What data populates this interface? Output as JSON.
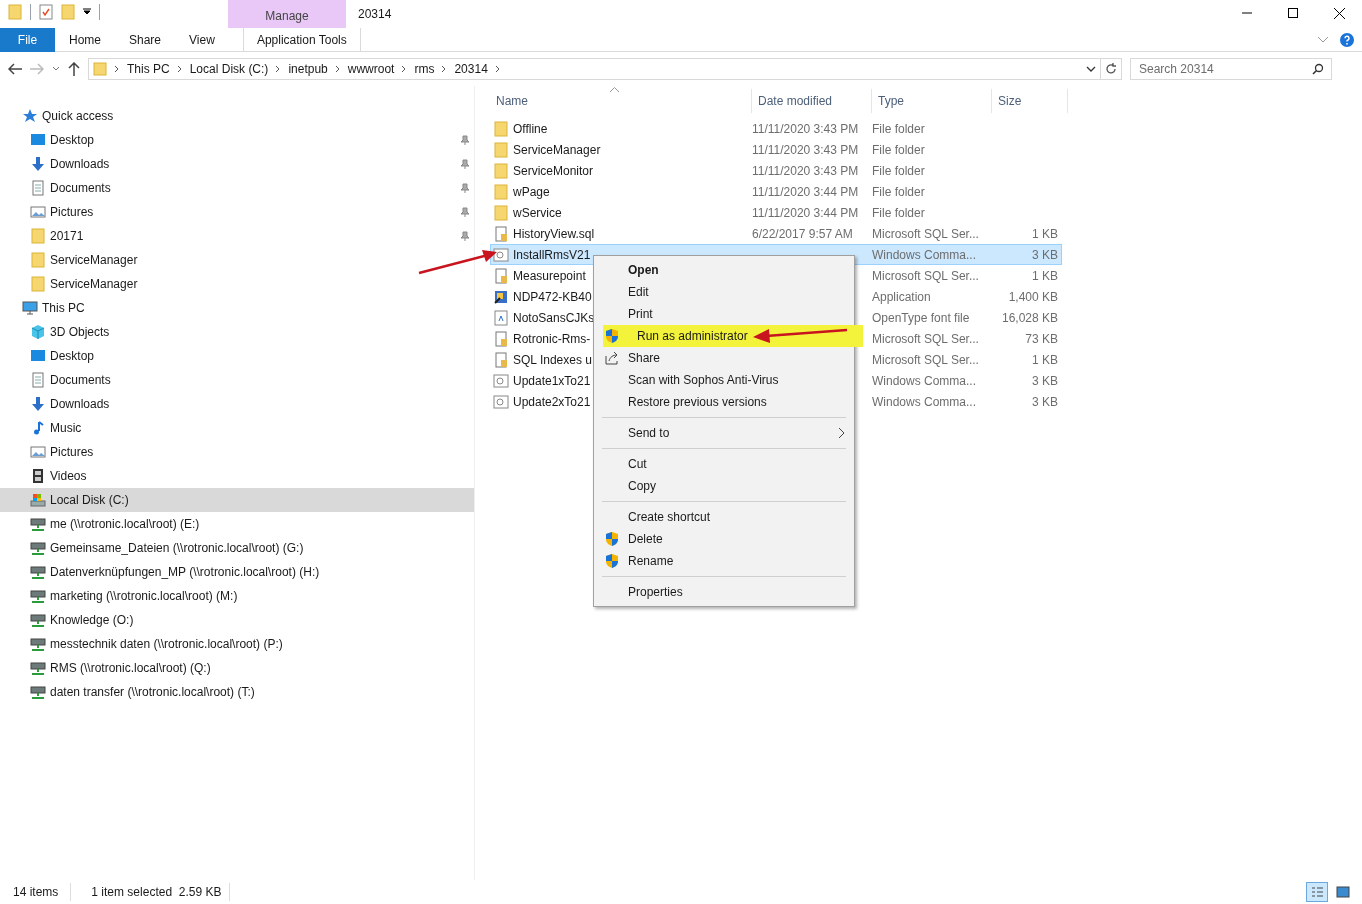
{
  "window": {
    "title": "20314",
    "context_tab_group": "Manage"
  },
  "ribbon_tabs": [
    {
      "label": "File",
      "kind": "file",
      "selected": false
    },
    {
      "label": "Home",
      "kind": "tab",
      "selected": false
    },
    {
      "label": "Share",
      "kind": "tab",
      "selected": false
    },
    {
      "label": "View",
      "kind": "tab",
      "selected": false
    },
    {
      "label": "Application Tools",
      "kind": "context",
      "selected": false
    }
  ],
  "breadcrumb": [
    "This PC",
    "Local Disk (C:)",
    "inetpub",
    "wwwroot",
    "rms",
    "20314"
  ],
  "search": {
    "placeholder": "Search 20314"
  },
  "sidebar": [
    {
      "label": "Quick access",
      "kind": "star",
      "selected": false,
      "children": [
        {
          "label": "Desktop",
          "kind": "desktop",
          "pinned": true,
          "selected": false
        },
        {
          "label": "Downloads",
          "kind": "download",
          "pinned": true,
          "selected": false
        },
        {
          "label": "Documents",
          "kind": "document",
          "pinned": true,
          "selected": false
        },
        {
          "label": "Pictures",
          "kind": "picture",
          "pinned": true,
          "selected": false
        },
        {
          "label": "20171",
          "kind": "folder",
          "pinned": true,
          "selected": false
        },
        {
          "label": "ServiceManager",
          "kind": "folder",
          "pinned": false,
          "selected": false
        },
        {
          "label": "ServiceManager",
          "kind": "folder",
          "pinned": false,
          "selected": false
        }
      ]
    },
    {
      "label": "This PC",
      "kind": "computer",
      "selected": false,
      "children": [
        {
          "label": "3D Objects",
          "kind": "cube",
          "pinned": false,
          "selected": false
        },
        {
          "label": "Desktop",
          "kind": "desktop",
          "pinned": false,
          "selected": false
        },
        {
          "label": "Documents",
          "kind": "document",
          "pinned": false,
          "selected": false
        },
        {
          "label": "Downloads",
          "kind": "download",
          "pinned": false,
          "selected": false
        },
        {
          "label": "Music",
          "kind": "music",
          "pinned": false,
          "selected": false
        },
        {
          "label": "Pictures",
          "kind": "picture",
          "pinned": false,
          "selected": false
        },
        {
          "label": "Videos",
          "kind": "video",
          "pinned": false,
          "selected": false
        },
        {
          "label": "Local Disk (C:)",
          "kind": "disk",
          "pinned": false,
          "selected": true
        },
        {
          "label": "me (\\\\rotronic.local\\root) (E:)",
          "kind": "netdrive",
          "pinned": false,
          "selected": false
        },
        {
          "label": "Gemeinsame_Dateien (\\\\rotronic.local\\root) (G:)",
          "kind": "netdrive",
          "pinned": false,
          "selected": false
        },
        {
          "label": "Datenverknüpfungen_MP (\\\\rotronic.local\\root) (H:)",
          "kind": "netdrive",
          "pinned": false,
          "selected": false
        },
        {
          "label": "marketing (\\\\rotronic.local\\root) (M:)",
          "kind": "netdrive",
          "pinned": false,
          "selected": false
        },
        {
          "label": "Knowledge (O:)",
          "kind": "netdrive",
          "pinned": false,
          "selected": false
        },
        {
          "label": "messtechnik daten (\\\\rotronic.local\\root) (P:)",
          "kind": "netdrive",
          "pinned": false,
          "selected": false
        },
        {
          "label": "RMS (\\\\rotronic.local\\root) (Q:)",
          "kind": "netdrive",
          "pinned": false,
          "selected": false
        },
        {
          "label": "daten transfer (\\\\rotronic.local\\root) (T:)",
          "kind": "netdrive",
          "pinned": false,
          "selected": false
        }
      ]
    }
  ],
  "table": {
    "columns": [
      "Name",
      "Date modified",
      "Type",
      "Size"
    ],
    "rows": [
      {
        "kind": "folder",
        "name": "Offline",
        "date": "11/11/2020 3:43 PM",
        "type": "File folder",
        "selected": false
      },
      {
        "kind": "folder",
        "name": "ServiceManager",
        "date": "11/11/2020 3:43 PM",
        "type": "File folder",
        "selected": false
      },
      {
        "kind": "folder",
        "name": "ServiceMonitor",
        "date": "11/11/2020 3:43 PM",
        "type": "File folder",
        "selected": false
      },
      {
        "kind": "folder",
        "name": "wPage",
        "date": "11/11/2020 3:44 PM",
        "type": "File folder",
        "selected": false
      },
      {
        "kind": "folder",
        "name": "wService",
        "date": "11/11/2020 3:44 PM",
        "type": "File folder",
        "selected": false
      },
      {
        "kind": "sql",
        "name": "HistoryView.sql",
        "date": "6/22/2017 9:57 AM",
        "type": "Microsoft SQL Ser...",
        "size": "1 KB",
        "selected": false
      },
      {
        "kind": "cmd",
        "name": "InstallRmsV21",
        "type": "Windows Comma...",
        "size": "3 KB",
        "selected": true
      },
      {
        "kind": "sql",
        "name": "Measurepoint",
        "type": "Microsoft SQL Ser...",
        "size": "1 KB",
        "selected": false
      },
      {
        "kind": "app",
        "name": "NDP472-KB40",
        "type": "Application",
        "size": "1,400 KB",
        "selected": false
      },
      {
        "kind": "font",
        "name": "NotoSansCJKs",
        "type": "OpenType font file",
        "size": "16,028 KB",
        "selected": false
      },
      {
        "kind": "sql",
        "name": "Rotronic-Rms-",
        "type": "Microsoft SQL Ser...",
        "size": "73 KB",
        "selected": false
      },
      {
        "kind": "sql",
        "name": "SQL Indexes u",
        "type": "Microsoft SQL Ser...",
        "size": "1 KB",
        "selected": false
      },
      {
        "kind": "cmd",
        "name": "Update1xTo21",
        "type": "Windows Comma...",
        "size": "3 KB",
        "selected": false
      },
      {
        "kind": "cmd",
        "name": "Update2xTo21",
        "type": "Windows Comma...",
        "size": "3 KB",
        "selected": false
      }
    ]
  },
  "context_menu": {
    "groups": [
      [
        {
          "label": "Open",
          "kind": "plain",
          "default": true,
          "highlighted": false,
          "submenu": false
        },
        {
          "label": "Edit",
          "kind": "plain",
          "default": false,
          "highlighted": false,
          "submenu": false
        },
        {
          "label": "Print",
          "kind": "plain",
          "default": false,
          "highlighted": false,
          "submenu": false
        },
        {
          "label": "Run as administrator",
          "kind": "shield",
          "default": false,
          "highlighted": true,
          "submenu": false
        },
        {
          "label": "Share",
          "kind": "share",
          "default": false,
          "highlighted": false,
          "submenu": false
        },
        {
          "label": "Scan with Sophos Anti-Virus",
          "kind": "plain",
          "default": false,
          "highlighted": false,
          "submenu": false
        },
        {
          "label": "Restore previous versions",
          "kind": "plain",
          "default": false,
          "highlighted": false,
          "submenu": false
        }
      ],
      [
        {
          "label": "Send to",
          "kind": "plain",
          "default": false,
          "highlighted": false,
          "submenu": true
        }
      ],
      [
        {
          "label": "Cut",
          "kind": "plain",
          "default": false,
          "highlighted": false,
          "submenu": false
        },
        {
          "label": "Copy",
          "kind": "plain",
          "default": false,
          "highlighted": false,
          "submenu": false
        }
      ],
      [
        {
          "label": "Create shortcut",
          "kind": "plain",
          "default": false,
          "highlighted": false,
          "submenu": false
        },
        {
          "label": "Delete",
          "kind": "shield",
          "default": false,
          "highlighted": false,
          "submenu": false
        },
        {
          "label": "Rename",
          "kind": "shield",
          "default": false,
          "highlighted": false,
          "submenu": false
        }
      ],
      [
        {
          "label": "Properties",
          "kind": "plain",
          "default": false,
          "highlighted": false,
          "submenu": false
        }
      ]
    ]
  },
  "status_bar": {
    "item_count": "14 items",
    "selection": "1 item selected  2.59 KB",
    "views": [
      {
        "kind": "details",
        "selected": true
      },
      {
        "kind": "large",
        "selected": false
      }
    ]
  }
}
